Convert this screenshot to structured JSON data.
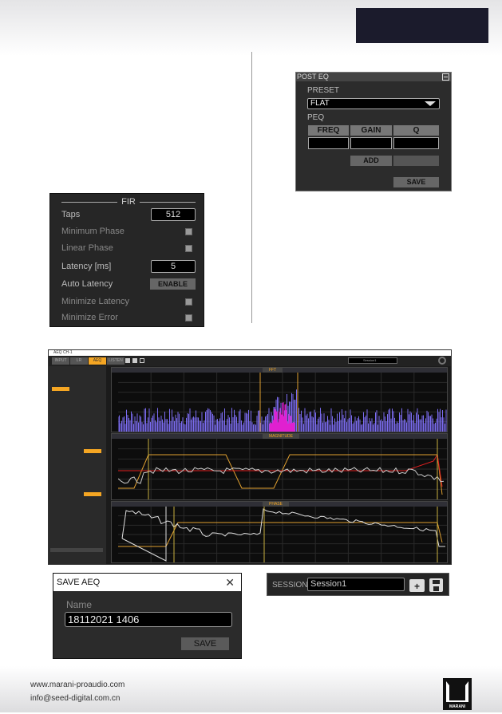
{
  "fir": {
    "title": "FIR",
    "taps_label": "Taps",
    "taps_value": "512",
    "min_phase": "Minimum Phase",
    "lin_phase": "Linear Phase",
    "latency_label": "Latency [ms]",
    "latency_value": "5",
    "auto_latency": "Auto Latency",
    "enable": "ENABLE",
    "min_latency": "Minimize Latency",
    "min_error": "Minimize Error"
  },
  "post_eq": {
    "title": "POST EQ",
    "preset_label": "PRESET",
    "preset_value": "FLAT",
    "peq_label": "PEQ",
    "cols": [
      "FREQ",
      "GAIN",
      "Q"
    ],
    "add": "ADD",
    "save": "SAVE"
  },
  "app": {
    "window_title": "AEQ CH-1",
    "tabs": [
      "INPUT",
      "LR",
      "AEQ",
      "LISTEN"
    ],
    "active_tab": "AEQ",
    "session_value": "Session1",
    "plots": [
      "FFT",
      "MAGNITUDE",
      "PHASE"
    ],
    "colors": {
      "accent": "#f5a623",
      "fft": "#7b6cf0",
      "peak": "#e020d0",
      "target": "#e0a030",
      "curve": "#e02020"
    }
  },
  "save_aeq": {
    "title": "SAVE AEQ",
    "name_label": "Name",
    "name_value": "18112021 1406",
    "save": "SAVE"
  },
  "session": {
    "label": "SESSION",
    "value": "Session1"
  },
  "footer": {
    "web": "www.marani-proaudio.com",
    "email": "info@seed-digital.com.cn",
    "logo_text": "MARANI"
  }
}
